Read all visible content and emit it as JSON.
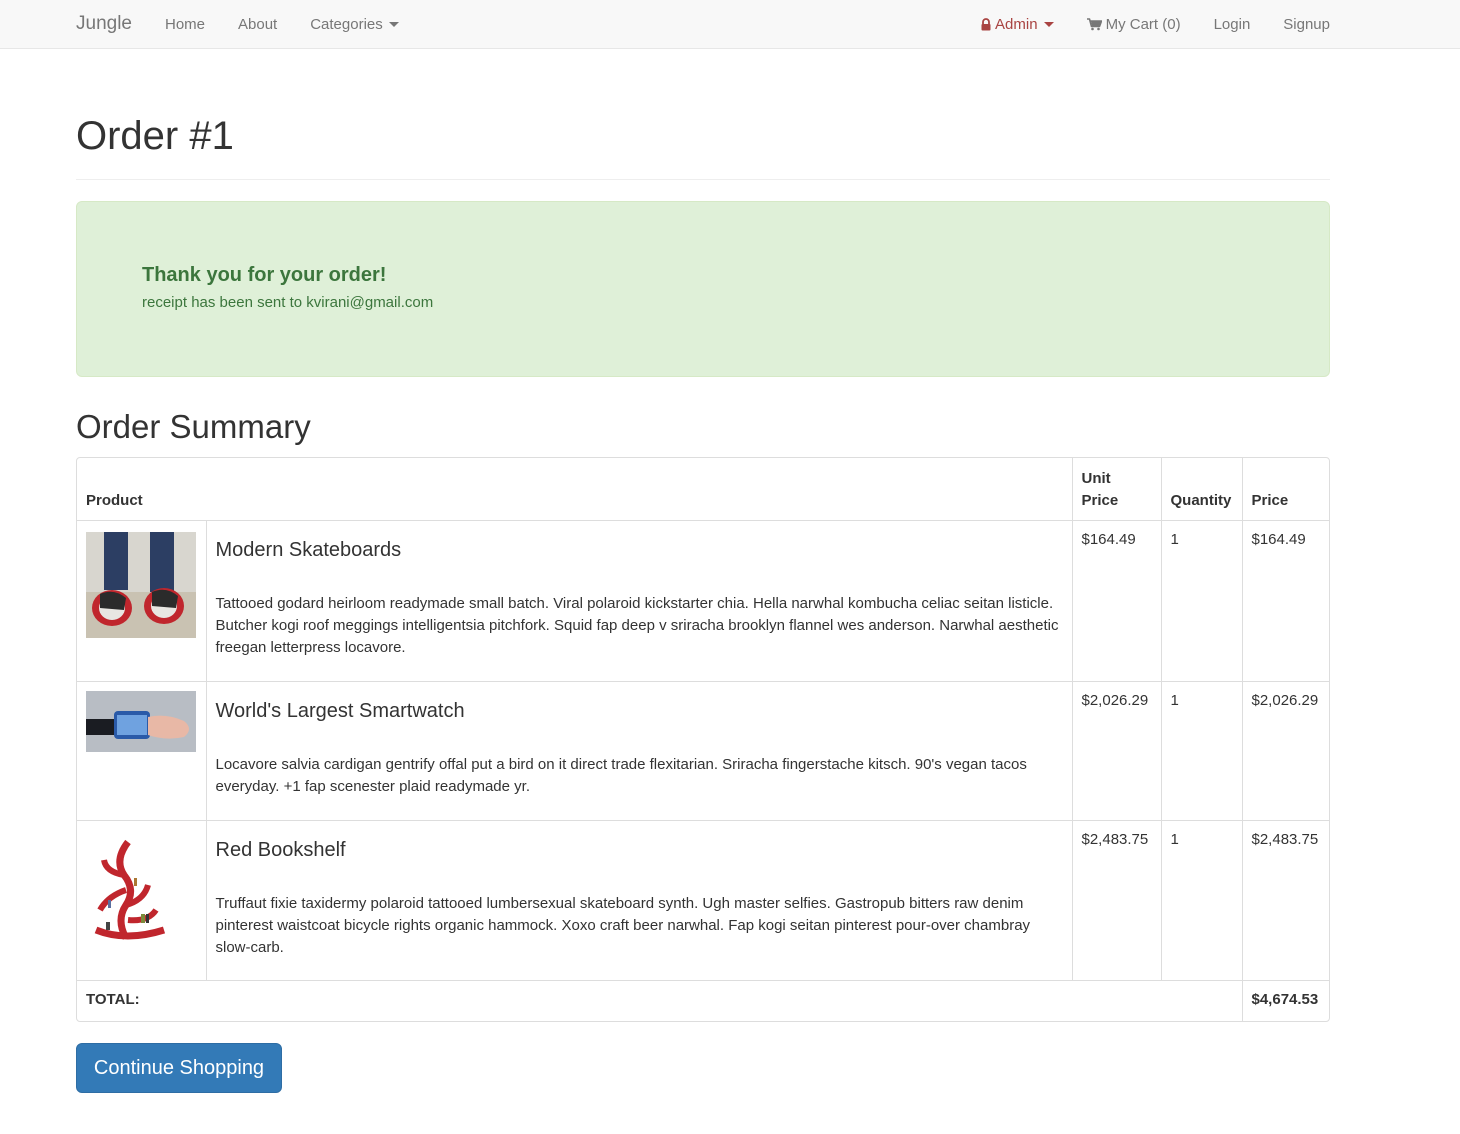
{
  "nav": {
    "brand": "Jungle",
    "home": "Home",
    "about": "About",
    "categories": "Categories",
    "admin": "Admin",
    "cart": "My Cart (0)",
    "login": "Login",
    "signup": "Signup"
  },
  "page": {
    "title": "Order #1"
  },
  "alert": {
    "title": "Thank you for your order!",
    "text": "receipt has been sent to kvirani@gmail.com"
  },
  "summary": {
    "title": "Order Summary",
    "headers": {
      "product": "Product",
      "unit_price": "Unit Price",
      "quantity": "Quantity",
      "price": "Price"
    },
    "items": [
      {
        "name": "Modern Skateboards",
        "description": "Tattooed godard heirloom readymade small batch. Viral polaroid kickstarter chia. Hella narwhal kombucha celiac seitan listicle. Butcher kogi roof meggings intelligentsia pitchfork. Squid fap deep v sriracha brooklyn flannel wes anderson. Narwhal aesthetic freegan letterpress locavore.",
        "unit_price": "$164.49",
        "quantity": "1",
        "price": "$164.49"
      },
      {
        "name": "World's Largest Smartwatch",
        "description": "Locavore salvia cardigan gentrify offal put a bird on it direct trade flexitarian. Sriracha fingerstache kitsch. 90's vegan tacos everyday. +1 fap scenester plaid readymade yr.",
        "unit_price": "$2,026.29",
        "quantity": "1",
        "price": "$2,026.29"
      },
      {
        "name": "Red Bookshelf",
        "description": "Truffaut fixie taxidermy polaroid tattooed lumbersexual skateboard synth. Ugh master selfies. Gastropub bitters raw denim pinterest waistcoat bicycle rights organic hammock. Xoxo craft beer narwhal. Fap kogi seitan pinterest pour-over chambray slow-carb.",
        "unit_price": "$2,483.75",
        "quantity": "1",
        "price": "$2,483.75"
      }
    ],
    "total_label": "TOTAL:",
    "total_value": "$4,674.53"
  },
  "actions": {
    "continue_label": "Continue Shopping"
  },
  "colors": {
    "brand_blue": "#337ab7",
    "alert_bg": "#dff0d8",
    "alert_text": "#3c763d",
    "admin_red": "#a94442"
  }
}
